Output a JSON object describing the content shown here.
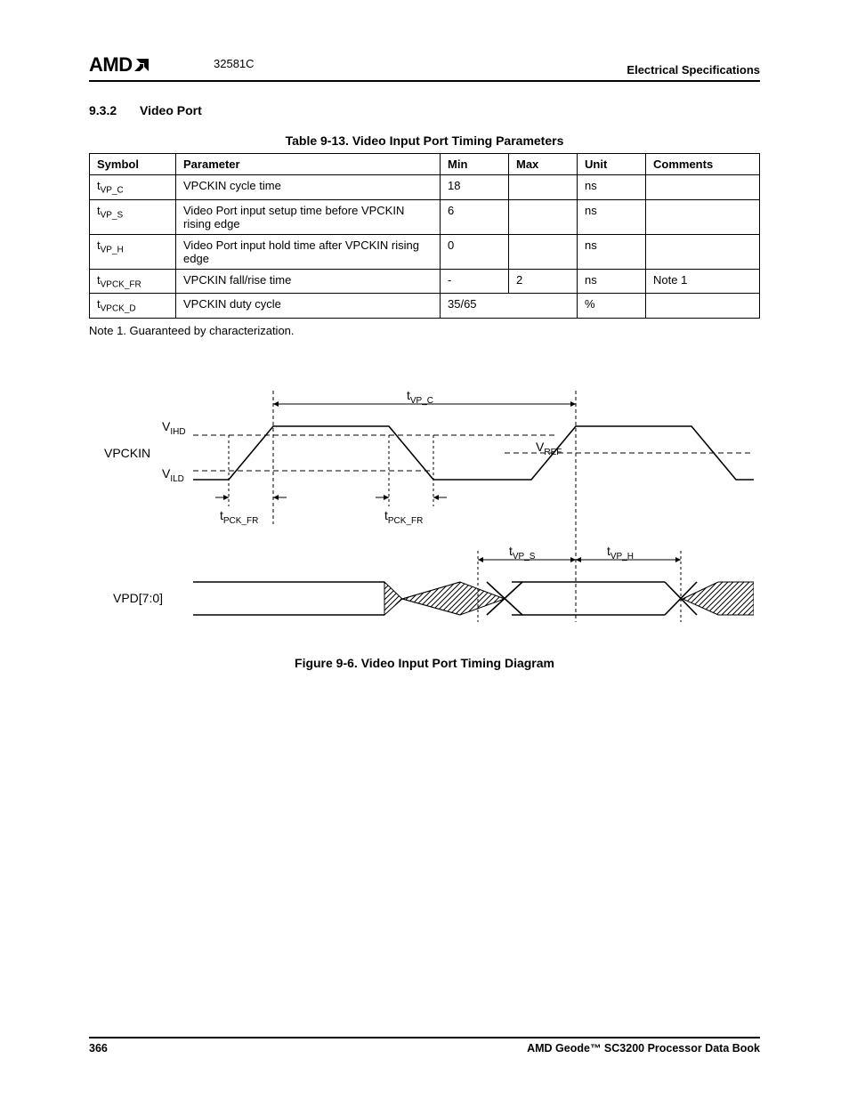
{
  "header": {
    "logo_text": "AMD",
    "doc_id": "32581C",
    "spec_title": "Electrical Specifications"
  },
  "section": {
    "number": "9.3.2",
    "title": "Video Port"
  },
  "table": {
    "caption": "Table 9-13.  Video Input Port Timing Parameters",
    "headers": {
      "symbol": "Symbol",
      "parameter": "Parameter",
      "min": "Min",
      "max": "Max",
      "unit": "Unit",
      "comments": "Comments"
    },
    "rows": [
      {
        "sym_pre": "t",
        "sym_sub": "VP_C",
        "param": "VPCKIN cycle time",
        "min": "18",
        "max": "",
        "unit": "ns",
        "comments": "",
        "merged": false
      },
      {
        "sym_pre": "t",
        "sym_sub": "VP_S",
        "param": "Video Port input setup time before VPCKIN rising edge",
        "min": "6",
        "max": "",
        "unit": "ns",
        "comments": "",
        "merged": false
      },
      {
        "sym_pre": "t",
        "sym_sub": "VP_H",
        "param": "Video Port input hold time after VPCKIN rising edge",
        "min": "0",
        "max": "",
        "unit": "ns",
        "comments": "",
        "merged": false
      },
      {
        "sym_pre": "t",
        "sym_sub": "VPCK_FR",
        "param": "VPCKIN fall/rise time",
        "min": "-",
        "max": "2",
        "unit": "ns",
        "comments": "Note 1",
        "merged": false
      },
      {
        "sym_pre": "t",
        "sym_sub": "VPCK_D",
        "param": "VPCKIN duty cycle",
        "min": "35/65",
        "max": "",
        "unit": "%",
        "comments": "",
        "merged": true
      }
    ],
    "note": "Note 1.   Guaranteed by characterization."
  },
  "figure": {
    "caption": "Figure 9-6.  Video Input Port Timing Diagram",
    "labels": {
      "vpckin": "VPCKIN",
      "vihd_pre": "V",
      "vihd_sub": "IHD",
      "vild_pre": "V",
      "vild_sub": "ILD",
      "vref_pre": "V",
      "vref_sub": "REF",
      "tvpc_pre": "t",
      "tvpc_sub": "VP_C",
      "tpckfr1_pre": "t",
      "tpckfr1_sub": "PCK_FR",
      "tpckfr2_pre": "t",
      "tpckfr2_sub": "PCK_FR",
      "tvps_pre": "t",
      "tvps_sub": "VP_S",
      "tvph_pre": "t",
      "tvph_sub": "VP_H",
      "vpd": "VPD[7:0]"
    }
  },
  "footer": {
    "page_number": "366",
    "book_title": "AMD Geode™ SC3200 Processor Data Book"
  }
}
